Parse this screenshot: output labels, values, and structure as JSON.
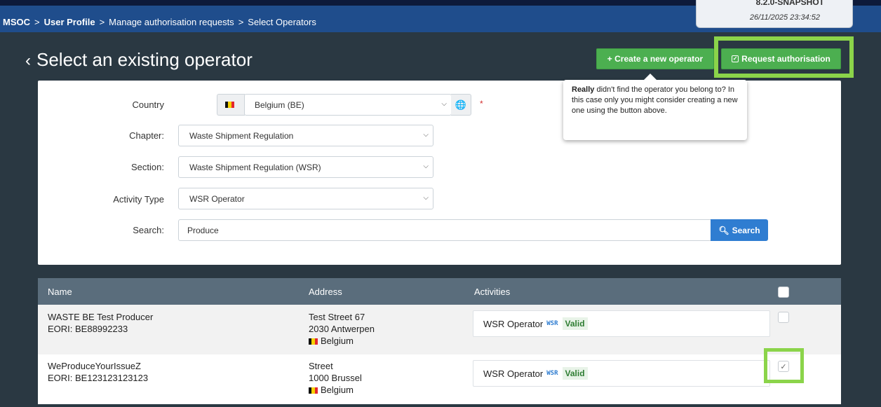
{
  "header": {
    "breadcrumb": [
      "MSOC",
      "User Profile",
      "Manage authorisation requests",
      "Select Operators"
    ],
    "breadcrumb_separator": ">",
    "version": "8.2.0-SNAPSHOT",
    "timestamp": "26/11/2025 23:34:52"
  },
  "page": {
    "title": "Select an existing operator",
    "back_icon": "chevron-left-icon"
  },
  "actions": {
    "create_operator": "+ Create a new operator",
    "request_authorisation": "Request authorisation",
    "request_icon": "checkbox-icon"
  },
  "tooltip": {
    "bold": "Really",
    "text": " didn't find the operator you belong to? In this case only you might consider creating a new one using the button above."
  },
  "form": {
    "country_label": "Country",
    "country_value": "Belgium (BE)",
    "chapter_label": "Chapter:",
    "chapter_value": "Waste Shipment Regulation",
    "section_label": "Section:",
    "section_value": "Waste Shipment Regulation (WSR)",
    "activity_type_label": "Activity Type",
    "activity_type_value": "WSR Operator",
    "search_label": "Search:",
    "search_value": "Produce",
    "search_button": "Search",
    "required_mark": "*"
  },
  "table": {
    "columns": [
      "Name",
      "Address",
      "Activities"
    ],
    "rows": [
      {
        "name": "WASTE BE Test Producer",
        "eori": "EORI: BE88992233",
        "street": "Test Street 67",
        "city": "2030 Antwerpen",
        "country": "Belgium",
        "activity": "WSR Operator",
        "activity_code": "WSR",
        "status": "Valid",
        "checked": false
      },
      {
        "name": "WeProduceYourIssueZ",
        "eori": "EORI: BE123123123123",
        "street": "Street",
        "city": "1000 Brussel",
        "country": "Belgium",
        "activity": "WSR Operator",
        "activity_code": "WSR",
        "status": "Valid",
        "checked": true
      }
    ]
  },
  "colors": {
    "topbar": "#1f4d8c",
    "background": "#2a3842",
    "button_green": "#4caf50",
    "button_blue": "#2f7dd1",
    "table_header": "#5a6d7c",
    "highlight": "#8bd44a",
    "valid_text": "#2e7d32"
  }
}
